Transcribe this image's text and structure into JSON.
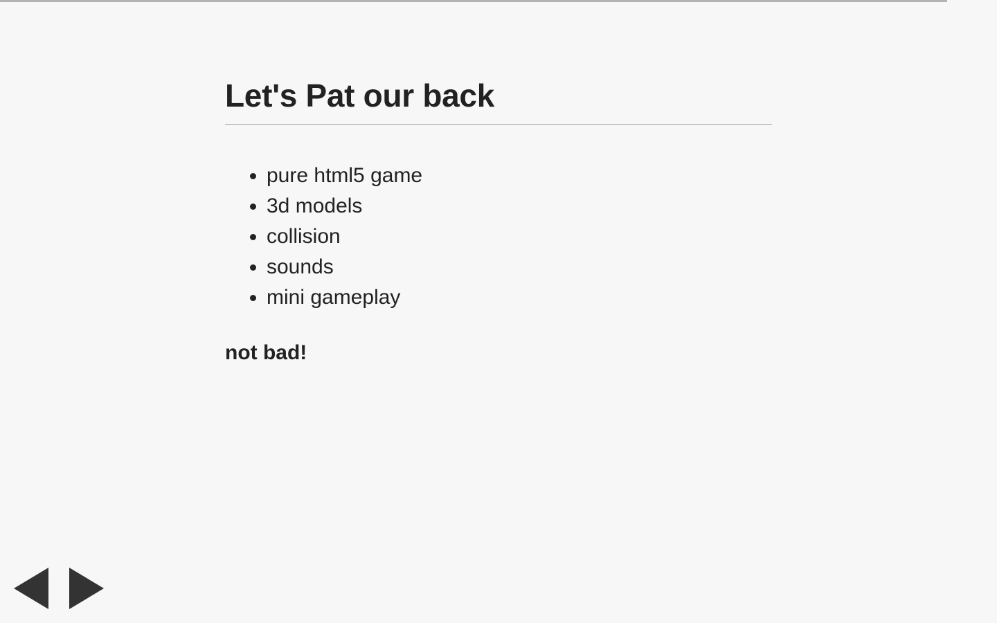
{
  "progress": {
    "fraction": 0.95,
    "color": "#b3b3b3"
  },
  "slide": {
    "title": "Let's Pat our back",
    "bullets": [
      "pure html5 game",
      "3d models",
      "collision",
      "sounds",
      "mini gameplay"
    ],
    "closing": "not bad!"
  },
  "navigation": {
    "prev_icon": "triangle-left-icon",
    "next_icon": "triangle-right-icon",
    "arrow_color": "#333333"
  },
  "colors": {
    "background": "#f7f7f7",
    "text": "#222222",
    "rule": "#aaaaaa"
  }
}
